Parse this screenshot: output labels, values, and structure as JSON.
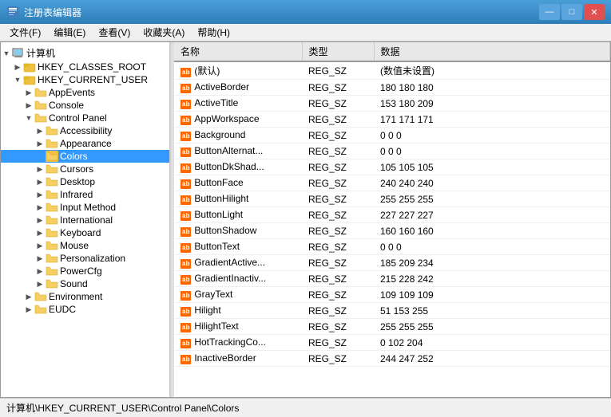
{
  "titleBar": {
    "title": "注册表编辑器",
    "icon": "regedit",
    "minLabel": "—",
    "maxLabel": "□",
    "closeLabel": "✕"
  },
  "menuBar": {
    "items": [
      {
        "id": "file",
        "label": "文件(F)"
      },
      {
        "id": "edit",
        "label": "编辑(E)"
      },
      {
        "id": "view",
        "label": "查看(V)"
      },
      {
        "id": "favorites",
        "label": "收藏夹(A)"
      },
      {
        "id": "help",
        "label": "帮助(H)"
      }
    ]
  },
  "treePane": {
    "nodes": [
      {
        "id": "computer",
        "label": "计算机",
        "indent": 0,
        "expanded": true,
        "selected": false,
        "type": "computer"
      },
      {
        "id": "hkcr",
        "label": "HKEY_CLASSES_ROOT",
        "indent": 1,
        "expanded": false,
        "selected": false,
        "type": "hive"
      },
      {
        "id": "hkcu",
        "label": "HKEY_CURRENT_USER",
        "indent": 1,
        "expanded": true,
        "selected": false,
        "type": "hive"
      },
      {
        "id": "appevents",
        "label": "AppEvents",
        "indent": 2,
        "expanded": false,
        "selected": false,
        "type": "folder"
      },
      {
        "id": "console",
        "label": "Console",
        "indent": 2,
        "expanded": false,
        "selected": false,
        "type": "folder"
      },
      {
        "id": "controlpanel",
        "label": "Control Panel",
        "indent": 2,
        "expanded": true,
        "selected": false,
        "type": "folder"
      },
      {
        "id": "accessibility",
        "label": "Accessibility",
        "indent": 3,
        "expanded": false,
        "selected": false,
        "type": "folder"
      },
      {
        "id": "appearance",
        "label": "Appearance",
        "indent": 3,
        "expanded": false,
        "selected": false,
        "type": "folder"
      },
      {
        "id": "colors",
        "label": "Colors",
        "indent": 3,
        "expanded": false,
        "selected": true,
        "type": "folder"
      },
      {
        "id": "cursors",
        "label": "Cursors",
        "indent": 3,
        "expanded": false,
        "selected": false,
        "type": "folder"
      },
      {
        "id": "desktop",
        "label": "Desktop",
        "indent": 3,
        "expanded": false,
        "selected": false,
        "type": "folder"
      },
      {
        "id": "infrared",
        "label": "Infrared",
        "indent": 3,
        "expanded": false,
        "selected": false,
        "type": "folder"
      },
      {
        "id": "inputmethod",
        "label": "Input Method",
        "indent": 3,
        "expanded": false,
        "selected": false,
        "type": "folder"
      },
      {
        "id": "international",
        "label": "International",
        "indent": 3,
        "expanded": false,
        "selected": false,
        "type": "folder"
      },
      {
        "id": "keyboard",
        "label": "Keyboard",
        "indent": 3,
        "expanded": false,
        "selected": false,
        "type": "folder"
      },
      {
        "id": "mouse",
        "label": "Mouse",
        "indent": 3,
        "expanded": false,
        "selected": false,
        "type": "folder"
      },
      {
        "id": "personalization",
        "label": "Personalization",
        "indent": 3,
        "expanded": false,
        "selected": false,
        "type": "folder"
      },
      {
        "id": "powercfg",
        "label": "PowerCfg",
        "indent": 3,
        "expanded": false,
        "selected": false,
        "type": "folder"
      },
      {
        "id": "sound",
        "label": "Sound",
        "indent": 3,
        "expanded": false,
        "selected": false,
        "type": "folder"
      },
      {
        "id": "environment",
        "label": "Environment",
        "indent": 2,
        "expanded": false,
        "selected": false,
        "type": "folder"
      },
      {
        "id": "eudc",
        "label": "EUDC",
        "indent": 2,
        "expanded": false,
        "selected": false,
        "type": "folder"
      }
    ]
  },
  "tableHeaders": {
    "name": "名称",
    "type": "类型",
    "data": "数据"
  },
  "registryEntries": [
    {
      "name": "(默认)",
      "type": "REG_SZ",
      "data": "(数值未设置)"
    },
    {
      "name": "ActiveBorder",
      "type": "REG_SZ",
      "data": "180 180 180"
    },
    {
      "name": "ActiveTitle",
      "type": "REG_SZ",
      "data": "153 180 209"
    },
    {
      "name": "AppWorkspace",
      "type": "REG_SZ",
      "data": "171 171 171"
    },
    {
      "name": "Background",
      "type": "REG_SZ",
      "data": "0 0 0"
    },
    {
      "name": "ButtonAlternat...",
      "type": "REG_SZ",
      "data": "0 0 0"
    },
    {
      "name": "ButtonDkShad...",
      "type": "REG_SZ",
      "data": "105 105 105"
    },
    {
      "name": "ButtonFace",
      "type": "REG_SZ",
      "data": "240 240 240"
    },
    {
      "name": "ButtonHilight",
      "type": "REG_SZ",
      "data": "255 255 255"
    },
    {
      "name": "ButtonLight",
      "type": "REG_SZ",
      "data": "227 227 227"
    },
    {
      "name": "ButtonShadow",
      "type": "REG_SZ",
      "data": "160 160 160"
    },
    {
      "name": "ButtonText",
      "type": "REG_SZ",
      "data": "0 0 0"
    },
    {
      "name": "GradientActive...",
      "type": "REG_SZ",
      "data": "185 209 234"
    },
    {
      "name": "GradientInactiv...",
      "type": "REG_SZ",
      "data": "215 228 242"
    },
    {
      "name": "GrayText",
      "type": "REG_SZ",
      "data": "109 109 109"
    },
    {
      "name": "Hilight",
      "type": "REG_SZ",
      "data": "51 153 255"
    },
    {
      "name": "HilightText",
      "type": "REG_SZ",
      "data": "255 255 255"
    },
    {
      "name": "HotTrackingCo...",
      "type": "REG_SZ",
      "data": "0 102 204"
    },
    {
      "name": "InactiveBorder",
      "type": "REG_SZ",
      "data": "244 247 252"
    }
  ],
  "statusBar": {
    "path": "计算机\\HKEY_CURRENT_USER\\Control Panel\\Colors"
  }
}
